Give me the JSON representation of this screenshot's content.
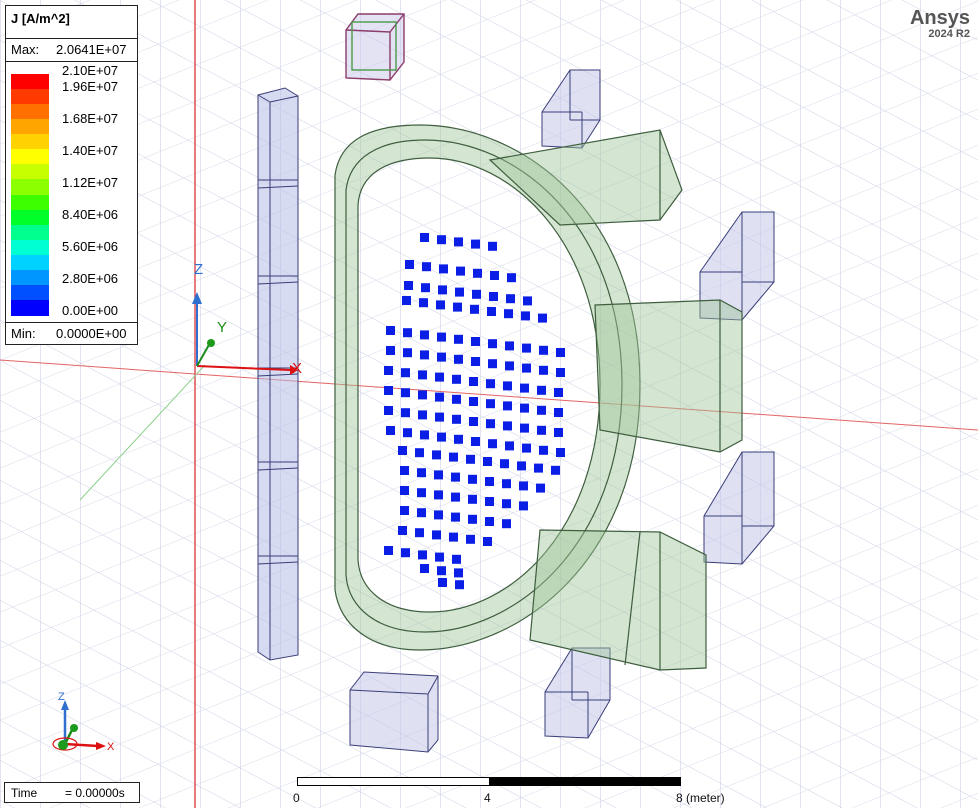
{
  "legend": {
    "title": "J [A/m^2]",
    "max_label": "Max:",
    "max_value": "2.0641E+07",
    "min_label": "Min:",
    "min_value": "0.0000E+00",
    "levels": [
      "2.10E+07",
      "1.96E+07",
      "1.68E+07",
      "1.40E+07",
      "1.12E+07",
      "8.40E+06",
      "5.60E+06",
      "2.80E+06",
      "0.00E+00"
    ],
    "colors": [
      "#ff0000",
      "#ff3a00",
      "#ff7000",
      "#ffa500",
      "#ffd200",
      "#ffff00",
      "#c8ff00",
      "#8cff00",
      "#3cff00",
      "#00ff28",
      "#00ff8c",
      "#00ffd2",
      "#00d2ff",
      "#0096ff",
      "#0050ff",
      "#0000ff"
    ]
  },
  "brand": {
    "name": "Ansys",
    "version": "2024 R2"
  },
  "axes": {
    "x": "X",
    "y": "Y",
    "z": "Z"
  },
  "time": {
    "label": "Time",
    "value": "=   0.00000s"
  },
  "scale": {
    "ticks": [
      "0",
      "4",
      "8 (meter)"
    ]
  }
}
